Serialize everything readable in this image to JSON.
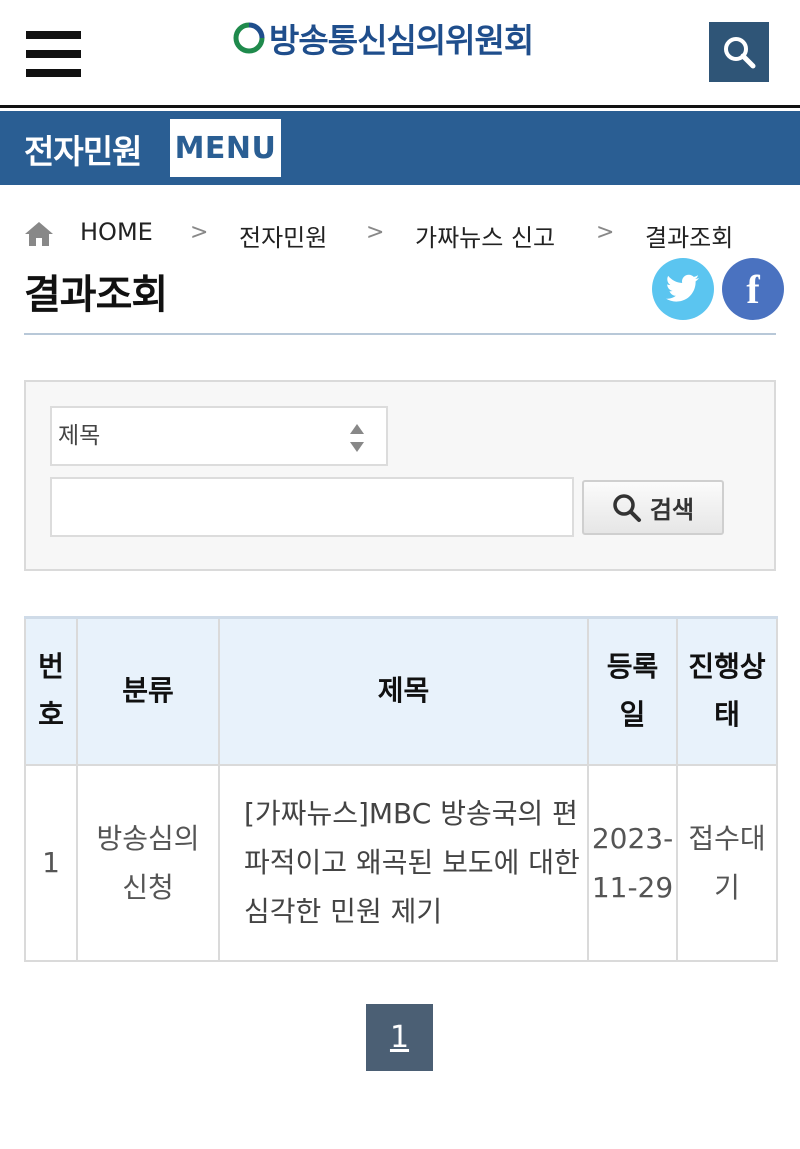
{
  "header": {
    "logo_text": "방송통신심의위원회",
    "menu_icon": "hamburger-icon",
    "search_icon": "search-icon"
  },
  "menubar": {
    "title": "전자민원",
    "menu_label": "MENU"
  },
  "breadcrumb": {
    "home_icon": "home-icon",
    "items": [
      "HOME",
      "전자민원",
      "가짜뉴스 신고",
      "결과조회"
    ],
    "separator": ">"
  },
  "page": {
    "title": "결과조회"
  },
  "search": {
    "field_select": "제목",
    "query_value": "",
    "submit_label": "검색"
  },
  "table": {
    "headers": [
      "번호",
      "분류",
      "제목",
      "등록일",
      "진행상태"
    ],
    "rows": [
      {
        "number": "1",
        "category": "방송심의신청",
        "title": "[가짜뉴스]MBC 방송국의 편파적이고 왜곡된 보도에 대한 심각한 민원 제기",
        "date": "2023-11-29",
        "status": "접수대기"
      }
    ]
  },
  "pagination": {
    "current_page": "1"
  },
  "colors": {
    "menubar": "#2a5e93",
    "search_button": "#2f5577",
    "table_header": "#e8f2fb",
    "twitter": "#5bc5f0",
    "facebook": "#4a72c0",
    "page_active": "#4b5f74"
  }
}
